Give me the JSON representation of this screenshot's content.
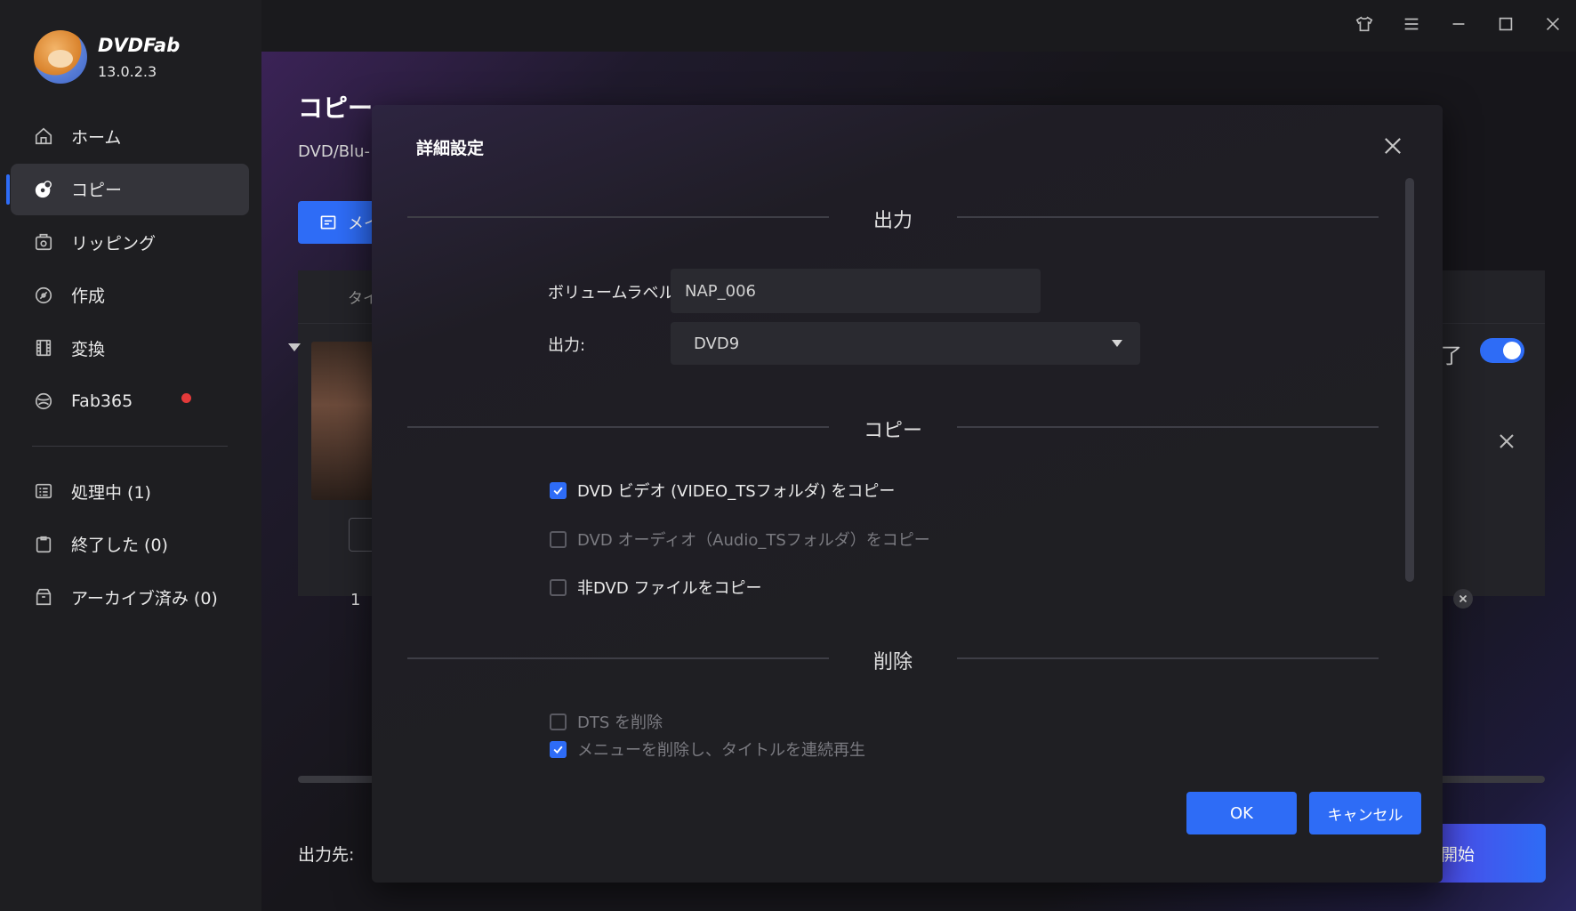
{
  "app": {
    "brand": "DVDFab",
    "version": "13.0.2.3"
  },
  "sidebar": {
    "items": [
      {
        "label": "ホーム",
        "icon": "home-icon",
        "active": false
      },
      {
        "label": "コピー",
        "icon": "disc-copy-icon",
        "active": true
      },
      {
        "label": "リッピング",
        "icon": "ripper-icon",
        "active": false
      },
      {
        "label": "作成",
        "icon": "creator-icon",
        "active": false
      },
      {
        "label": "変換",
        "icon": "film-icon",
        "active": false
      },
      {
        "label": "Fab365",
        "icon": "fab365-icon",
        "active": false,
        "badge": "red-dot"
      }
    ],
    "queue": [
      {
        "label": "処理中 (1)",
        "icon": "list-icon"
      },
      {
        "label": "終了した (0)",
        "icon": "clipboard-icon"
      },
      {
        "label": "アーカイブ済み (0)",
        "icon": "archive-icon"
      }
    ]
  },
  "main": {
    "title": "コピー",
    "subtitle": "DVD/Blu-",
    "main_button": "メイ",
    "panel_header": "タイ",
    "row_number": "1",
    "right_label": "了",
    "output_label": "出力先:",
    "start_button": "開始"
  },
  "dialog": {
    "title": "詳細設定",
    "sections": {
      "output": "出力",
      "copy": "コピー",
      "remove": "削除"
    },
    "volume_label": {
      "label": "ボリュームラベル:",
      "value": "NAP_006"
    },
    "output_select": {
      "label": "出力:",
      "value": "DVD9"
    },
    "copy_options": [
      {
        "label": "DVD ビデオ (VIDEO_TSフォルダ) をコピー",
        "checked": true,
        "disabled": false
      },
      {
        "label": "DVD オーディオ（Audio_TSフォルダ）をコピー",
        "checked": false,
        "disabled": true
      },
      {
        "label": "非DVD ファイルをコピー",
        "checked": false,
        "disabled": false
      }
    ],
    "remove_options": [
      {
        "label": "DTS を削除",
        "checked": false,
        "disabled": true
      },
      {
        "label": "メニューを削除し、タイトルを連続再生",
        "checked": true,
        "disabled": true
      }
    ],
    "ok_button": "OK",
    "cancel_button": "キャンセル"
  },
  "colors": {
    "accent": "#2e6cf6",
    "sidebar_bg": "#1e1e21",
    "dialog_bg": "#1f1f23"
  }
}
